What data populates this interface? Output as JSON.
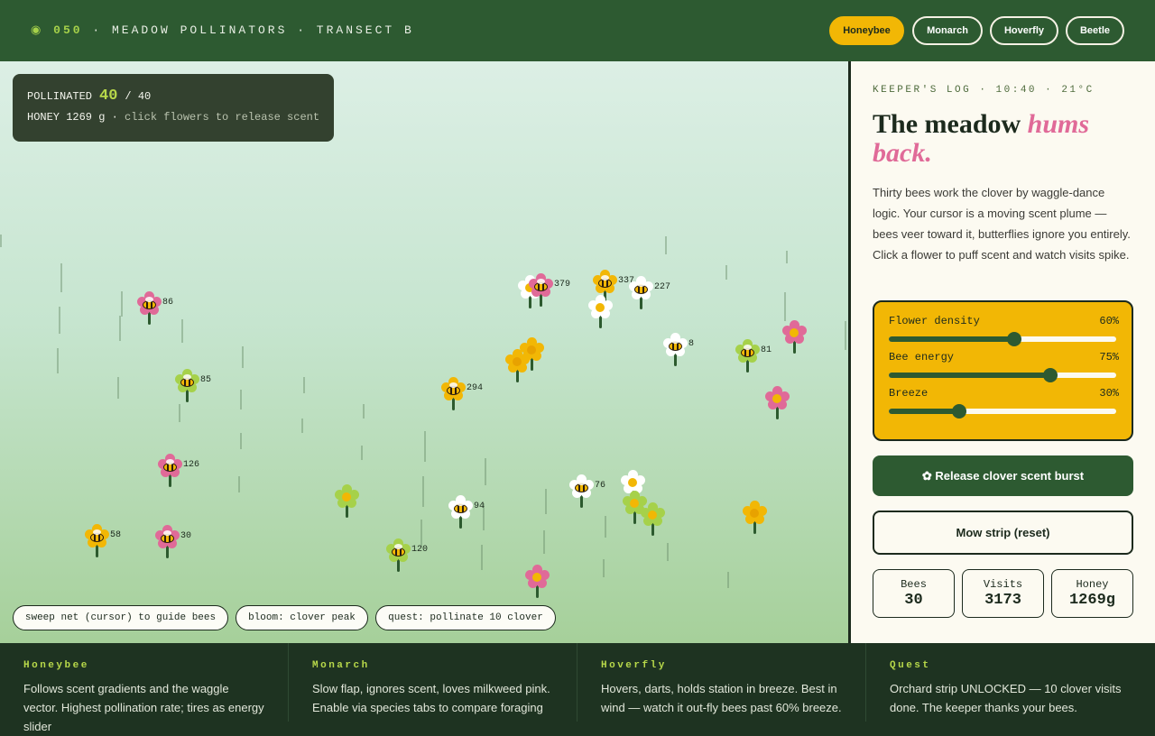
{
  "header": {
    "dot": "◉",
    "code": "050",
    "title": "· MEADOW POLLINATORS · TRANSECT B",
    "tabs": [
      "Honeybee",
      "Monarch",
      "Hoverfly",
      "Beetle"
    ],
    "active_tab": "Honeybee"
  },
  "hud": {
    "pollinated_label": "POLLINATED",
    "pollinated_value": "40",
    "pollinated_total": "/ 40",
    "honey_line": "HONEY 1269 g ·",
    "hint": "click flowers to release scent"
  },
  "field_pills": [
    "sweep net (cursor) to guide bees",
    "bloom: clover peak",
    "quest: pollinate 10 clover"
  ],
  "visit_counts": [
    "86",
    "85",
    "126",
    "58",
    "30",
    "294",
    "94",
    "120",
    "379",
    "337",
    "227",
    "8",
    "81",
    "76"
  ],
  "panel": {
    "log": "KEEPER'S LOG · 10:40 · 21°C",
    "headline_plain": "The meadow ",
    "headline_accent": "hums back.",
    "description": "Thirty bees work the clover by waggle-dance logic. Your cursor is a moving scent plume — bees veer toward it, butterflies ignore you entirely. Click a flower to puff scent and watch visits spike.",
    "sliders": [
      {
        "label": "Flower density",
        "display": "60%",
        "value": 0.55
      },
      {
        "label": "Bee energy",
        "display": "75%",
        "value": 0.71
      },
      {
        "label": "Breeze",
        "display": "30%",
        "value": 0.31
      }
    ],
    "burst_button": "✿ Release clover scent burst",
    "mow_button": "Mow strip (reset)",
    "stats": [
      {
        "label": "Bees",
        "value": "30"
      },
      {
        "label": "Visits",
        "value": "3173"
      },
      {
        "label": "Honey",
        "value": "1269g"
      }
    ]
  },
  "footer": [
    {
      "title": "Honeybee",
      "body": "Follows scent gradients and the waggle vector. Highest pollination rate; tires as energy slider"
    },
    {
      "title": "Monarch",
      "body": "Slow flap, ignores scent, loves milkweed pink. Enable via species tabs to compare foraging"
    },
    {
      "title": "Hoverfly",
      "body": "Hovers, darts, holds station in breeze. Best in wind — watch it out-fly bees past 60% breeze."
    },
    {
      "title": "Quest",
      "body": "Orchard strip UNLOCKED — 10 clover visits done. The keeper thanks your bees."
    }
  ],
  "colors": {
    "forest": "#2d5a31",
    "gold": "#f2b705",
    "pink": "#e06a98",
    "lime": "#b8d94a",
    "cream": "#fcfaf1"
  }
}
